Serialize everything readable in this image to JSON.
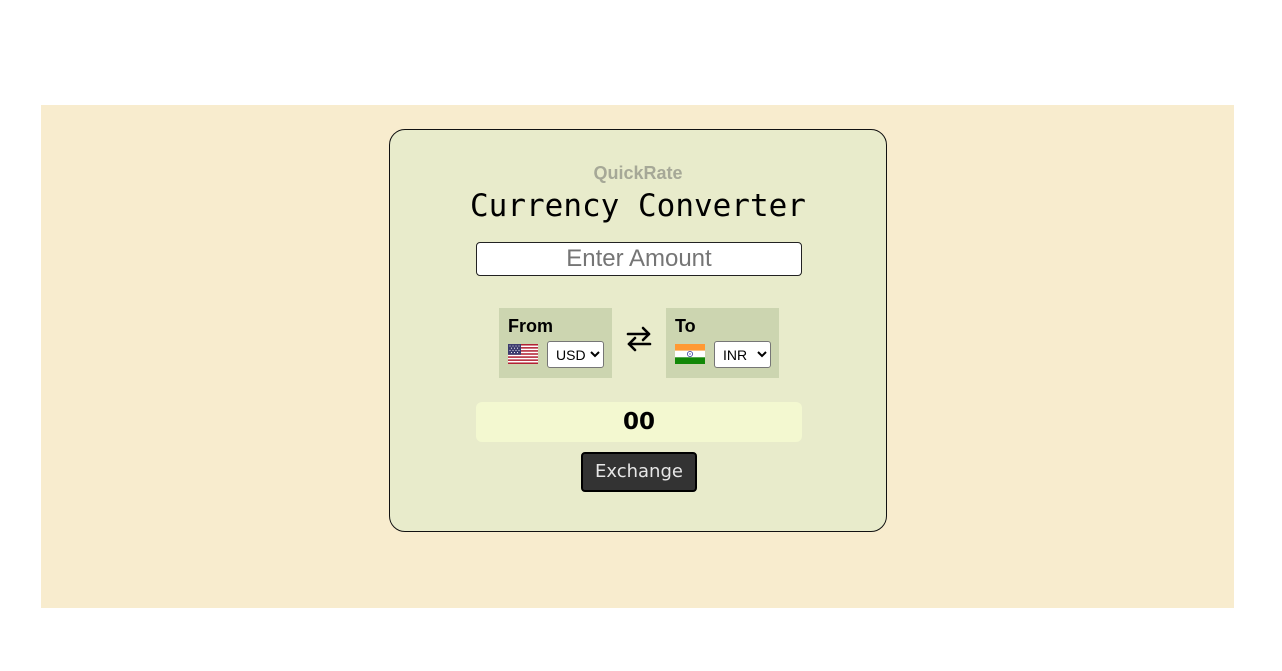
{
  "app": {
    "brand": "QuickRate",
    "title": "Currency Converter"
  },
  "amount_input": {
    "placeholder": "Enter Amount",
    "value": ""
  },
  "from": {
    "label": "From",
    "flag_icon": "us-flag-icon",
    "selected_currency": "USD"
  },
  "swap": {
    "icon": "swap-arrows-icon"
  },
  "to": {
    "label": "To",
    "flag_icon": "india-flag-icon",
    "selected_currency": "INR"
  },
  "result": {
    "value": "00"
  },
  "exchange_button": {
    "label": "Exchange"
  },
  "colors": {
    "page_background": "#f8ecce",
    "card_background": "#e8ebcb",
    "currency_box": "#ccd5b0",
    "result_background": "#f3f8d0",
    "button_background": "#333333",
    "brand_text": "#a6a897"
  }
}
